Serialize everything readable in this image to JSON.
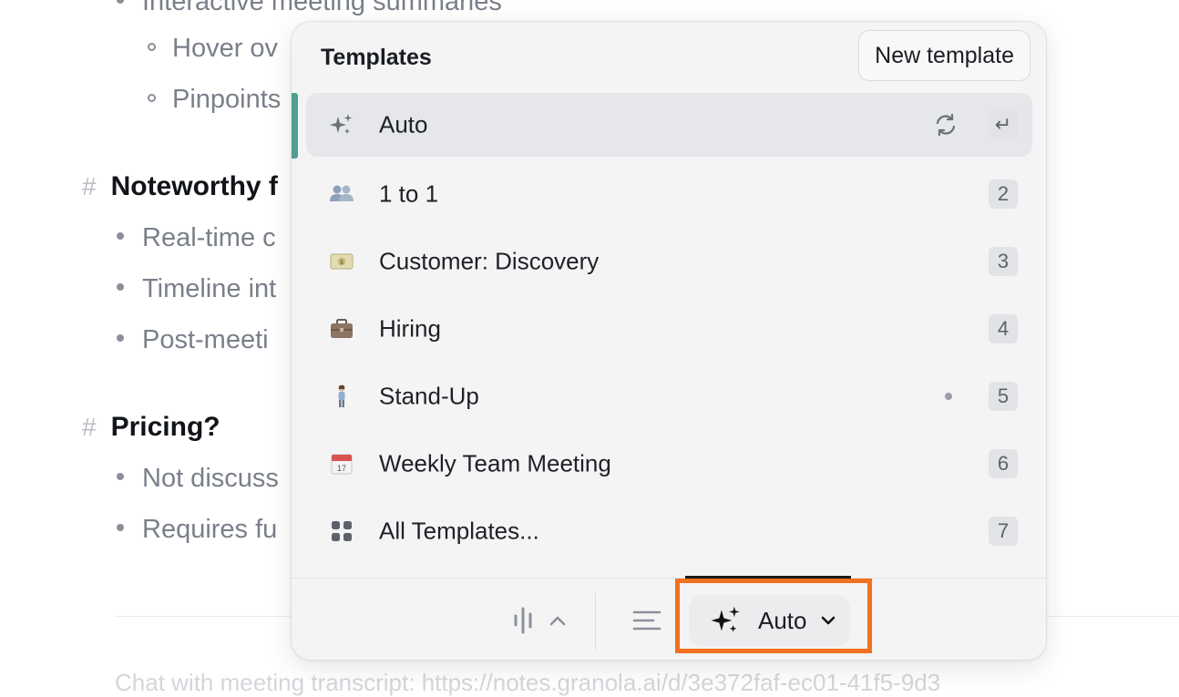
{
  "document": {
    "top_bullet": "Interactive meeting summaries",
    "sub_bullets": [
      "Hover ov",
      "Pinpoints"
    ],
    "section1": {
      "hash": "#",
      "title": "Noteworthy f",
      "items": [
        "Real-time c",
        "Timeline int",
        "Post-meeti"
      ]
    },
    "section2": {
      "hash": "#",
      "title": "Pricing?",
      "items": [
        "Not discuss",
        "Requires fu"
      ]
    },
    "chat_prompt": "Chat with meeting transcript: https://notes.granola.ai/d/3e372faf-ec01-41f5-9d3"
  },
  "templates_menu": {
    "title": "Templates",
    "new_template_label": "New template",
    "items": [
      {
        "icon": "sparkles-icon",
        "label": "Auto",
        "shortcut": "↵",
        "selected": true
      },
      {
        "icon": "people-icon",
        "label": "1 to 1",
        "shortcut": "2"
      },
      {
        "icon": "money-icon",
        "label": "Customer: Discovery",
        "shortcut": "3"
      },
      {
        "icon": "briefcase-icon",
        "label": "Hiring",
        "shortcut": "4"
      },
      {
        "icon": "person-standing-icon",
        "label": "Stand-Up",
        "shortcut": "5"
      },
      {
        "icon": "calendar-icon",
        "label": "Weekly Team Meeting",
        "shortcut": "6",
        "calendar_day": "17"
      },
      {
        "icon": "grid-icon",
        "label": "All Templates...",
        "shortcut": "7"
      }
    ]
  },
  "footer": {
    "template_selector_label": "Auto"
  },
  "colors": {
    "accent_teal": "#4f9e8f",
    "highlight_orange": "#f2701f"
  }
}
